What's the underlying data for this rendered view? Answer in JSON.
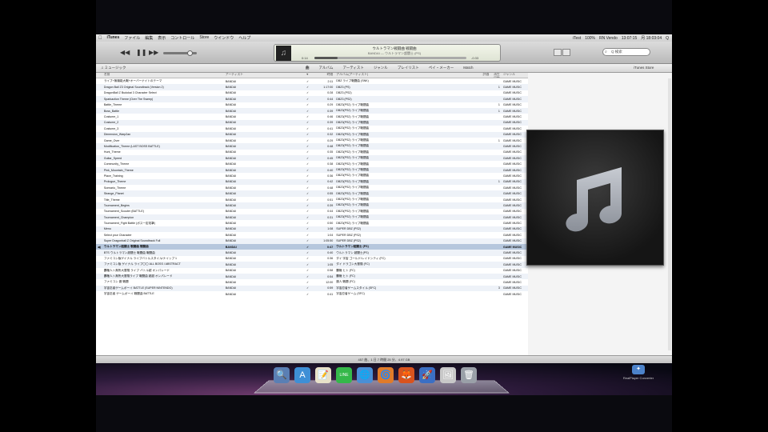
{
  "menubar": {
    "apple": "",
    "items": [
      "iTunes",
      "ファイル",
      "編集",
      "表示",
      "コントロール",
      "Store",
      "ウインドウ",
      "ヘルプ"
    ],
    "status": [
      "iTest",
      "100%",
      "RN Vendo",
      "13:07:15",
      "月 18:03:04",
      "Q"
    ]
  },
  "toolbar": {
    "prev": "◀◀",
    "pause": "❚❚",
    "next": "▶▶",
    "now_playing_title": "ウルトラマン戦闘曲 戦闘曲",
    "now_playing_sub": "BANDAI — ウルトラマン超闘士 (PS)",
    "elapsed": "0:14",
    "remaining": "-0:33",
    "progress": 0.15,
    "search_placeholder": "Q 検索"
  },
  "subbar": {
    "source": "♫ ミュージック",
    "tabs": [
      "曲",
      "アルバム",
      "アーティスト",
      "ジャンル",
      "プレイリスト",
      "ペイ・メーカー",
      "Match"
    ],
    "active_tab": "曲",
    "radio": "iTunes Store"
  },
  "columns": [
    "",
    "名前",
    "アーティスト",
    "♥",
    "時間",
    "アルバム(アーティスト)",
    "評価",
    "再生回数",
    "ジャンル"
  ],
  "tracks": [
    [
      "",
      "ライブ+無機能大戦+オーバーナイトのテーマ",
      "BANDAI",
      "✓",
      "2:11",
      "DBZ ライブ戦闘曲 (SNK)",
      "",
      "",
      "GAME MUSIC"
    ],
    [
      "",
      "Dragon Ball Z3 Original Soundtrack (Version 2)",
      "BANDAI",
      "✓",
      "1:17:00",
      "DBZ3 (PS)",
      "",
      "1",
      "GAME MUSIC"
    ],
    [
      "",
      "DragonBall Z Budokai 3 Character Select",
      "BANDAI",
      "✓",
      "0:28",
      "DBZ3 (PS2)",
      "",
      "",
      "GAME MUSIC"
    ],
    [
      "",
      "Sparkaction Theme (Over The Sweep)",
      "BANDAI",
      "✓",
      "0:44",
      "DBZ3 (PS2)",
      "",
      "",
      "GAME MUSIC"
    ],
    [
      "",
      "Battle_Theme",
      "BANDAI",
      "✓",
      "0:29",
      "DBZ3(PS2) ライブ戦闘曲",
      "",
      "1",
      "GAME MUSIC"
    ],
    [
      "",
      "Boss_Battle",
      "BANDAI",
      "✓",
      "0:39",
      "DBZ3(PS2) ライブ戦闘曲",
      "",
      "1",
      "GAME MUSIC"
    ],
    [
      "",
      "Costume_1",
      "BANDAI",
      "✓",
      "0:46",
      "DBZ3(PS2) ライブ戦闘曲",
      "",
      "",
      "GAME MUSIC"
    ],
    [
      "",
      "Costume_2",
      "BANDAI",
      "✓",
      "0:39",
      "DBZ3(PS2) ライブ戦闘曲",
      "",
      "",
      "GAME MUSIC"
    ],
    [
      "",
      "Costume_3",
      "BANDAI",
      "✓",
      "0:41",
      "DBZ3(PS2) ライブ戦闘曲",
      "",
      "",
      "GAME MUSIC"
    ],
    [
      "",
      "Dimension_Warp2an",
      "BANDAI",
      "✓",
      "0:32",
      "DBZ3(PS2) ライブ戦闘曲",
      "",
      "",
      "GAME MUSIC"
    ],
    [
      "",
      "Game_Over",
      "BANDAI",
      "✓",
      "0:29",
      "DBZ3(PS2) ライブ戦闘曲",
      "",
      "1",
      "GAME MUSIC"
    ],
    [
      "",
      "Modification_Theme (LAST BOSS BATTLE)",
      "BANDAI",
      "✓",
      "0:48",
      "DBZ3(PS2) ライブ戦闘曲",
      "",
      "",
      "GAME MUSIC"
    ],
    [
      "",
      "Hunt_Theme",
      "BANDAI",
      "✓",
      "0:35",
      "DBZ3(PS2) ライブ戦闘曲",
      "",
      "",
      "GAME MUSIC"
    ],
    [
      "",
      "Guitar_Speed",
      "BANDAI",
      "✓",
      "0:45",
      "DBZ3(PS2) ライブ戦闘曲",
      "",
      "",
      "GAME MUSIC"
    ],
    [
      "",
      "Community_Theme",
      "BANDAI",
      "✓",
      "0:38",
      "DBZ3(PS2) ライブ戦闘曲",
      "",
      "",
      "GAME MUSIC"
    ],
    [
      "",
      "Pink_Mountain_Theme",
      "BANDAI",
      "✓",
      "0:40",
      "DBZ3(PS2) ライブ戦闘曲",
      "",
      "",
      "GAME MUSIC"
    ],
    [
      "",
      "Place_Training",
      "BANDAI",
      "✓",
      "0:36",
      "DBZ3(PS2) ライブ戦闘曲",
      "",
      "",
      "GAME MUSIC"
    ],
    [
      "",
      "Prologue_Theme",
      "BANDAI",
      "✓",
      "0:42",
      "DBZ3(PS2) ライブ戦闘曲",
      "",
      "1",
      "GAME MUSIC"
    ],
    [
      "",
      "Scenario_Theme",
      "BANDAI",
      "✓",
      "0:48",
      "DBZ3(PS2) ライブ戦闘曲",
      "",
      "",
      "GAME MUSIC"
    ],
    [
      "",
      "Strange_Planet",
      "BANDAI",
      "✓",
      "0:55",
      "DBZ3(PS2) ライブ戦闘曲",
      "",
      "",
      "GAME MUSIC"
    ],
    [
      "",
      "Title_Theme",
      "BANDAI",
      "✓",
      "0:51",
      "DBZ3(PS2) ライブ戦闘曲",
      "",
      "",
      "GAME MUSIC"
    ],
    [
      "",
      "Tournament_Begins",
      "BANDAI",
      "✓",
      "0:39",
      "DBZ3(PS2) ライブ戦闘曲",
      "",
      "",
      "GAME MUSIC"
    ],
    [
      "",
      "Tournament_Scouter (BATTLE)",
      "BANDAI",
      "✓",
      "0:44",
      "DBZ3(PS2) ライブ戦闘曲",
      "",
      "",
      "GAME MUSIC"
    ],
    [
      "",
      "Tournament_Champion",
      "BANDAI",
      "✓",
      "0:31",
      "DBZ3(PS2) ライブ戦闘曲",
      "",
      "",
      "GAME MUSIC"
    ],
    [
      "",
      "Tournament_Fight Battle (ボス一定攻撃)",
      "BANDAI",
      "✓",
      "0:50",
      "DBZ3(PS2) ライブ戦闘曲",
      "",
      "",
      "GAME MUSIC"
    ],
    [
      "",
      "Menu",
      "BANDAI",
      "✓",
      "1:08",
      "SUPER DBZ (PS2)",
      "",
      "",
      "GAME MUSIC"
    ],
    [
      "",
      "Select your Character",
      "BANDAI",
      "✓",
      "1:04",
      "SUPER DBZ (PS2)",
      "",
      "",
      "GAME MUSIC"
    ],
    [
      "",
      "Super Dragonball Z Original Soundtrack Full",
      "BANDAI",
      "✓",
      "1:05:50",
      "SUPER DBZ (PS2)",
      "",
      "",
      "GAME MUSIC"
    ],
    [
      "◀)",
      "ウルトラマン超闘士 戦闘曲 戦闘曲",
      "BANDAI",
      "✓",
      "0:47",
      "ウルトラマン超闘士 (PS)",
      "",
      "",
      "GAME MUSIC"
    ],
    [
      "",
      "BTS ウルトラマン超闘士 戦闘曲 戦闘曲",
      "BANDAI",
      "✓",
      "0:40",
      "ウルトラマン 超闘士(PS)",
      "",
      "",
      "GAME MUSIC"
    ],
    [
      "",
      "ファミコン版ゲイナル ライブバトルスタイル/ナイップ 1",
      "BANDAI",
      "✓",
      "0:36",
      "ダイ 宇宙 ゴールド/レイドシティ (FC)",
      "",
      "",
      "GAME MUSIC"
    ],
    [
      "",
      "ファミコン版 ゲイナル ライブ〇〇 ALL BOSS / ABSTRACT",
      "BANDAI",
      "✓",
      "1:05",
      "ダイ ドラゴン大冒険 (FC)",
      "",
      "",
      "GAME MUSIC"
    ],
    [
      "",
      "覇権人ト無所大冒険 ライブ バトル超 オンパレード",
      "BANDAI",
      "✓",
      "0:58",
      "覇権 ヒト (FC)",
      "",
      "",
      "GAME MUSIC"
    ],
    [
      "",
      "覇権人ト無所大冒険ライブ 戦闘曲 超越 オンパレード",
      "BANDAI",
      "✓",
      "0:54",
      "覇権 ヒト (FC)",
      "",
      "",
      "GAME MUSIC"
    ],
    [
      "",
      "ファミコン 魔 戦闘",
      "BANDAI",
      "✓",
      "12:00",
      "魔人 戦闘 (FC)",
      "",
      "",
      "GAME MUSIC"
    ],
    [
      "",
      "宇宙忍者ゲームボーイ BATTLE (SUPER NINTENDO)",
      "BANDAI",
      "✓",
      "0:59",
      "宇宙忍者ゲームスタイル (SFC)",
      "",
      "3",
      "GAME MUSIC"
    ],
    [
      "",
      "宇宙忍者 ゲームボーイ 戦闘曲 BATTLE",
      "BANDAI",
      "✓",
      "0:41",
      "宇宙忍者ゲーム (SFC)",
      "",
      "",
      "GAME MUSIC"
    ]
  ],
  "selected_index": 28,
  "status_text": "457 曲、1 日 7 時間 25 分、4.97 GB",
  "dock": [
    "🔍",
    "A",
    "📝",
    "LINE",
    "🌐",
    "🌀",
    "🦊",
    "🚀",
    "🖼",
    "🗑"
  ],
  "realplayer": "RealPlayer Converter",
  "colors": {
    "selection": "#b6c7dd",
    "stripe": "#eef2f8"
  }
}
